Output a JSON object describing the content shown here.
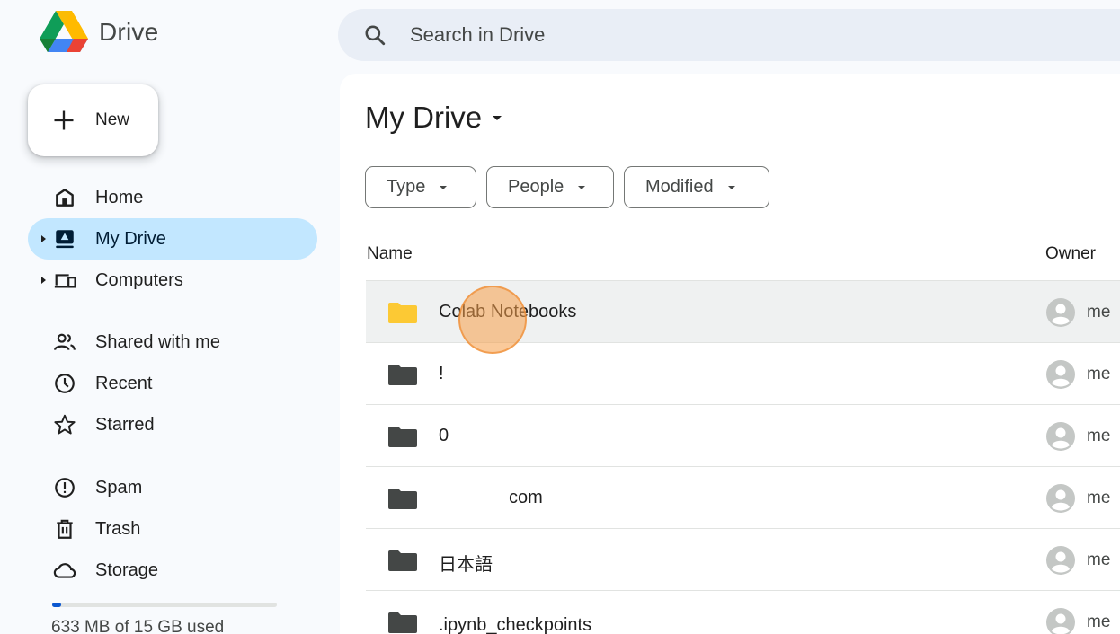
{
  "app": {
    "name": "Drive"
  },
  "search": {
    "placeholder": "Search in Drive"
  },
  "new_button": {
    "label": "New"
  },
  "sidebar": {
    "items": [
      {
        "label": "Home",
        "icon": "home-icon"
      },
      {
        "label": "My Drive",
        "icon": "my-drive-icon",
        "active": true
      },
      {
        "label": "Computers",
        "icon": "computers-icon"
      },
      {
        "label": "Shared with me",
        "icon": "shared-icon"
      },
      {
        "label": "Recent",
        "icon": "clock-icon"
      },
      {
        "label": "Starred",
        "icon": "star-icon"
      },
      {
        "label": "Spam",
        "icon": "spam-icon"
      },
      {
        "label": "Trash",
        "icon": "trash-icon"
      },
      {
        "label": "Storage",
        "icon": "cloud-icon"
      }
    ]
  },
  "storage": {
    "text": "633 MB of 15 GB used",
    "used_fraction": 0.04
  },
  "main": {
    "title": "My Drive",
    "filters": [
      "Type",
      "People",
      "Modified"
    ],
    "columns": {
      "name": "Name",
      "owner": "Owner"
    },
    "rows": [
      {
        "name": "Colab Notebooks",
        "owner": "me",
        "folder_color": "#fcc934"
      },
      {
        "name": "!",
        "owner": "me",
        "folder_color": "#444746"
      },
      {
        "name": "0",
        "owner": "me",
        "folder_color": "#444746"
      },
      {
        "name": "com",
        "owner": "me",
        "folder_color": "#444746"
      },
      {
        "name": "日本語",
        "owner": "me",
        "folder_color": "#444746"
      },
      {
        "name": ".ipynb_checkpoints",
        "owner": "me",
        "folder_color": "#444746"
      }
    ]
  },
  "colors": {
    "active_nav": "#c2e7ff",
    "accent": "#0b57d0",
    "click_marker": "#f69e48"
  }
}
